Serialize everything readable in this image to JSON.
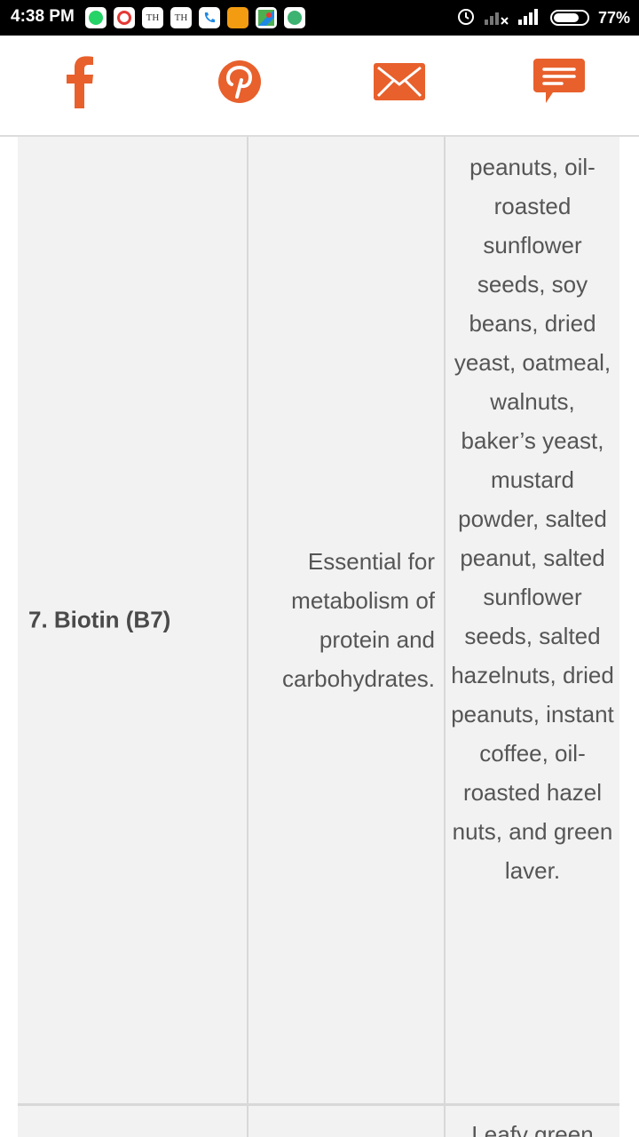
{
  "status_bar": {
    "time": "4:38 PM",
    "notifications": [
      {
        "name": "whatsapp",
        "color": "#25d366"
      },
      {
        "name": "alarm",
        "color": "#e53935"
      },
      {
        "name": "the-hindu",
        "text": "TH"
      },
      {
        "name": "the-hindu",
        "text": "TH"
      },
      {
        "name": "phone",
        "color": "#1e88e5"
      },
      {
        "name": "jabong",
        "color": "#f39c12"
      },
      {
        "name": "maps",
        "color": "#4caf50"
      },
      {
        "name": "hike",
        "color": "#3cb371"
      }
    ],
    "battery": "77%",
    "battery_level": 0.77
  },
  "share_bar": {
    "accent": "#e8602c",
    "buttons": [
      {
        "name": "facebook-icon"
      },
      {
        "name": "pinterest-icon"
      },
      {
        "name": "email-icon"
      },
      {
        "name": "comment-icon"
      }
    ]
  },
  "table": {
    "rows": [
      {
        "vitamin": "7. Biotin (B7)",
        "function": "Essential for metabolism of protein and carbohydrates.",
        "sources": "Oil-roasted peanuts, oil-roasted sunflower seeds, soy beans, dried yeast, oatmeal, walnuts, baker’s yeast, mustard powder, salted peanut, salted sunflower seeds, salted hazelnuts, dried peanuts, instant coffee, oil-roasted hazel nuts, and green laver."
      },
      {
        "vitamin": "",
        "function": "",
        "sources": "Leafy green"
      }
    ]
  }
}
